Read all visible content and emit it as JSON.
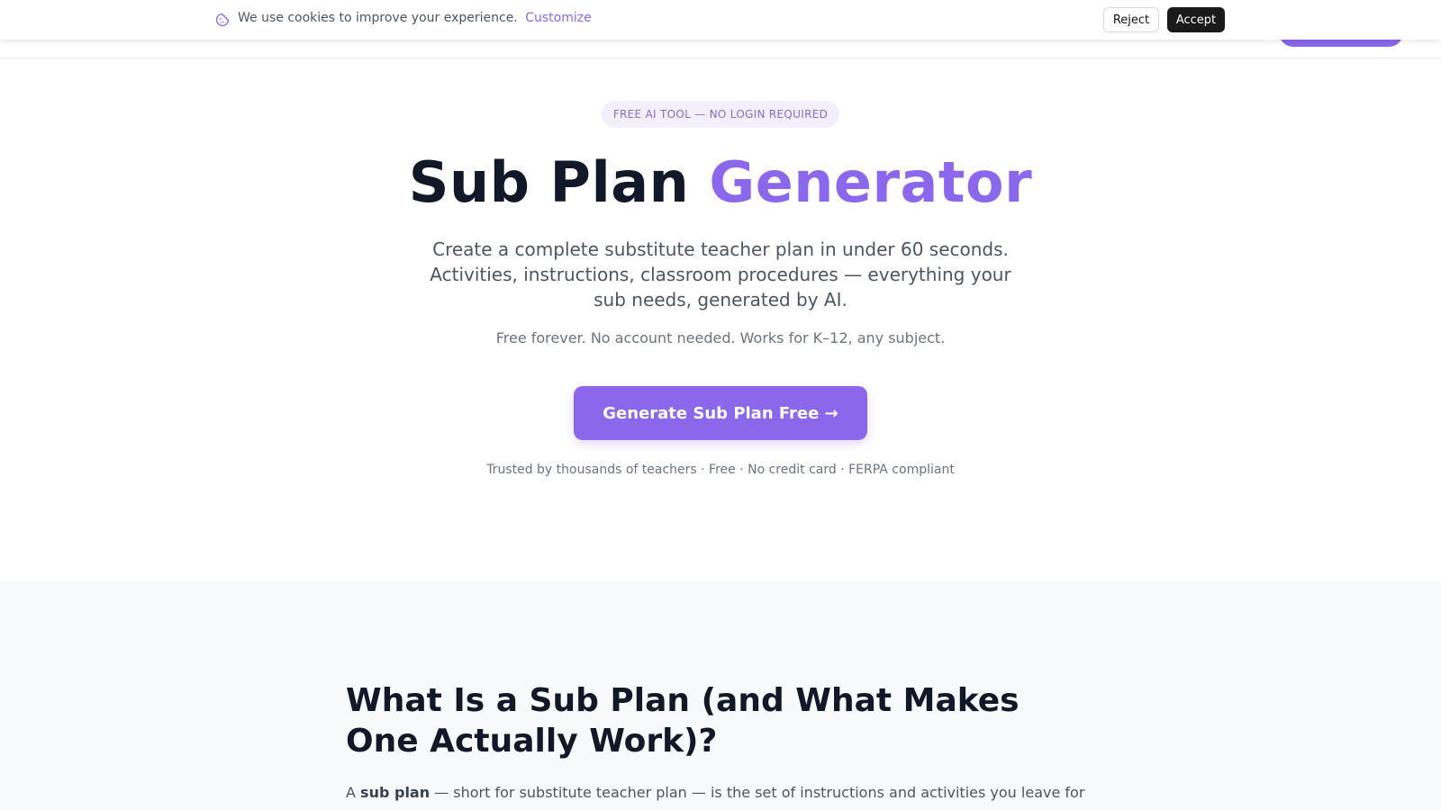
{
  "cookie_banner": {
    "text": "We use cookies to improve your experience.",
    "customize_label": "Customize",
    "reject_label": "Reject",
    "accept_label": "Accept",
    "icon": "cookie-icon"
  },
  "hero": {
    "badge": "FREE AI TOOL — NO LOGIN REQUIRED",
    "title_main": "Sub Plan",
    "title_accent": "Generator",
    "description": "Create a complete substitute teacher plan in under 60 seconds. Activities, instructions, classroom procedures — everything your sub needs, generated by AI.",
    "subtext": "Free forever. No account needed. Works for K–12, any subject.",
    "cta_label": "Generate Sub Plan Free →",
    "trust_line": "Trusted by thousands of teachers · Free · No credit card · FERPA compliant"
  },
  "section_what_is": {
    "title": "What Is a Sub Plan (and What Makes One Actually Work)?",
    "body_prefix": "A",
    "body_bold": "sub plan",
    "body_rest": "— short for substitute teacher plan — is the set of instructions and activities you leave for"
  },
  "colors": {
    "accent": "#8b67ec",
    "text_dark": "#111827",
    "text_muted": "#6b7280",
    "accept_button": "#1a1a1a"
  }
}
